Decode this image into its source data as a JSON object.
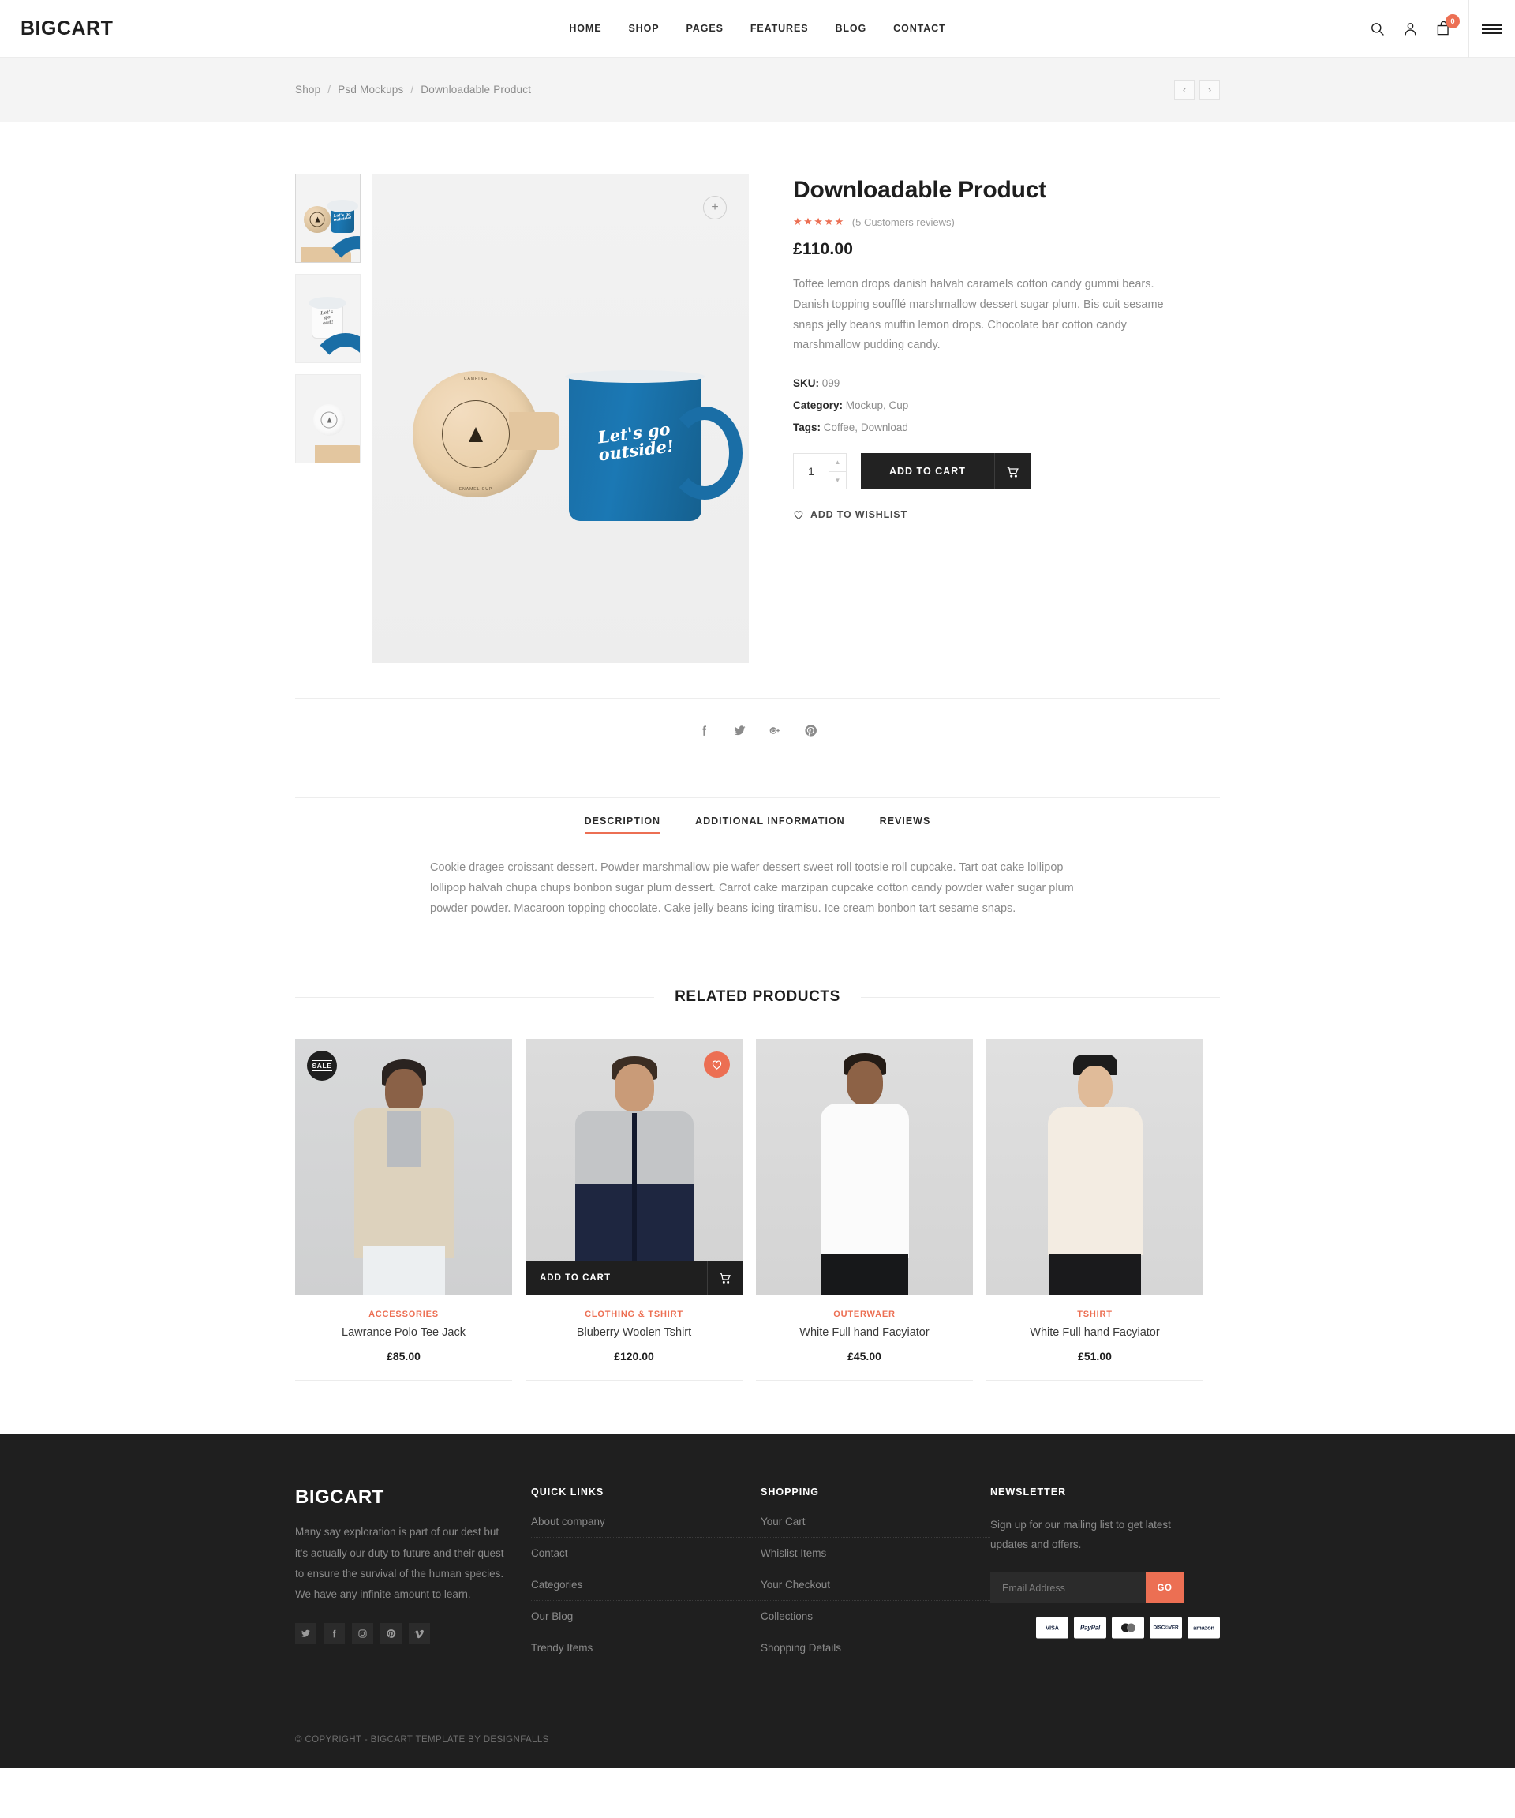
{
  "header": {
    "brand": "BIGCART",
    "nav": [
      "HOME",
      "SHOP",
      "PAGES",
      "FEATURES",
      "BLOG",
      "CONTACT"
    ],
    "cart_count": "0"
  },
  "breadcrumb": {
    "items": [
      "Shop",
      "Psd Mockups",
      "Downloadable Product"
    ],
    "sep": "/"
  },
  "product": {
    "title": "Downloadable Product",
    "stars": "★★★★★",
    "reviews": "(5 Customers reviews)",
    "price": "£110.00",
    "description": "Toffee lemon drops danish halvah caramels cotton candy gummi bears. Danish topping soufflé marshmallow dessert sugar plum. Bis cuit sesame snaps jelly beans muffin lemon drops. Chocolate bar cotton candy marshmallow pudding candy.",
    "sku_label": "SKU:",
    "sku_value": "099",
    "category_label": "Category:",
    "category_value": "Mockup, Cup",
    "tags_label": "Tags:",
    "tags_value": "Coffee, Download",
    "quantity": "1",
    "add_to_cart": "ADD TO CART",
    "wishlist": "ADD TO WISHLIST",
    "mug_text": "Let's go\noutside!"
  },
  "share": [
    "facebook-icon",
    "twitter-icon",
    "google-plus-icon",
    "pinterest-icon"
  ],
  "tabs": {
    "items": [
      "DESCRIPTION",
      "ADDITIONAL INFORMATION",
      "REVIEWS"
    ],
    "active": "DESCRIPTION",
    "body": "Cookie dragee croissant dessert. Powder marshmallow pie wafer dessert sweet roll tootsie roll cupcake. Tart oat cake lollipop lollipop halvah chupa chups bonbon sugar plum dessert. Carrot cake marzipan cupcake cotton candy powder wafer sugar plum powder powder. Macaroon topping chocolate. Cake jelly beans icing tiramisu. Ice cream bonbon tart sesame snaps."
  },
  "related": {
    "heading": "RELATED PRODUCTS",
    "sale_badge": "SALE",
    "add_to_cart": "ADD TO CART",
    "items": [
      {
        "category": "ACCESSORIES",
        "name": "Lawrance Polo Tee Jack",
        "price": "£85.00"
      },
      {
        "category": "CLOTHING & TSHIRT",
        "name": "Bluberry Woolen Tshirt",
        "price": "£120.00"
      },
      {
        "category": "OUTERWAER",
        "name": "White Full hand Facyiator",
        "price": "£45.00"
      },
      {
        "category": "TSHIRT",
        "name": "White Full hand Facyiator",
        "price": "£51.00"
      }
    ]
  },
  "footer": {
    "logo": "BIGCART",
    "about": "Many say exploration is part of our dest but it's actually our duty to future and their quest to ensure the survival of the human species. We have any infinite amount to learn.",
    "social": [
      "twitter-icon",
      "facebook-icon",
      "instagram-icon",
      "pinterest-icon",
      "vimeo-icon"
    ],
    "quick_links_head": "QUICK LINKS",
    "quick_links": [
      "About company",
      "Contact",
      "Categories",
      "Our Blog",
      "Trendy Items"
    ],
    "shopping_head": "SHOPPING",
    "shopping": [
      "Your Cart",
      "Whislist Items",
      "Your Checkout",
      "Collections",
      "Shopping Details"
    ],
    "newsletter_head": "NEWSLETTER",
    "newsletter_text": "Sign up for our mailing list to get latest updates and offers.",
    "email_placeholder": "Email Address",
    "go": "GO",
    "copyright": "© COPYRIGHT - BIGCART TEMPLATE BY DESIGNFALLS",
    "payments": [
      "VISA",
      "PayPal",
      "MasterCard",
      "DISC©VER",
      "amazon"
    ]
  },
  "colors": {
    "accent": "#ec6f53",
    "dark": "#1f1f1f",
    "muted": "#8b8b8b"
  }
}
